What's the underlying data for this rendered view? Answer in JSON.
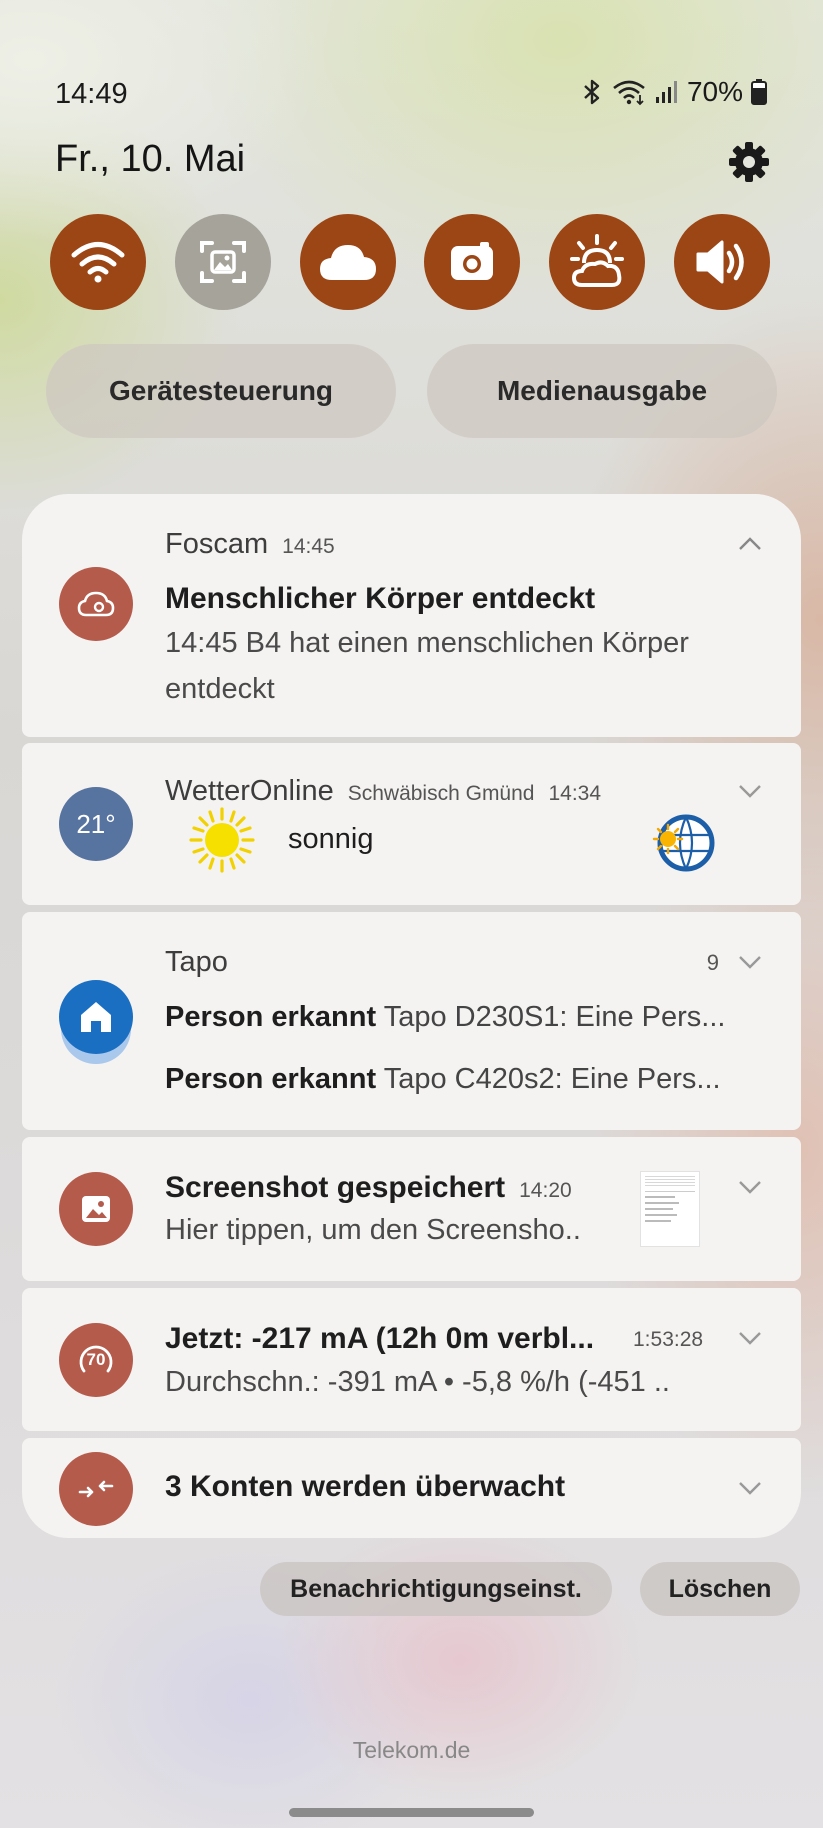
{
  "status": {
    "time": "14:49",
    "battery_pct": "70%",
    "icons": [
      "bluetooth-icon",
      "wifi-icon",
      "signal-icon",
      "battery-icon"
    ]
  },
  "header": {
    "date": "Fr., 10. Mai",
    "settings_icon": "gear-icon"
  },
  "quick_settings": [
    {
      "name": "wifi",
      "icon": "wifi-icon",
      "active": true
    },
    {
      "name": "screenshot",
      "icon": "screen-capture-icon",
      "active": false
    },
    {
      "name": "cloud",
      "icon": "cloud-icon",
      "active": true
    },
    {
      "name": "camera",
      "icon": "camera-icon",
      "active": true
    },
    {
      "name": "weather",
      "icon": "sun-cloud-icon",
      "active": true
    },
    {
      "name": "sound",
      "icon": "speaker-icon",
      "active": true
    }
  ],
  "pills": {
    "device_control": "Gerätesteuerung",
    "media_output": "Medienausgabe"
  },
  "notifications": {
    "foscam": {
      "app": "Foscam",
      "time": "14:45",
      "title": "Menschlicher Körper entdeckt",
      "body": "14:45 B4 hat einen menschlichen Körper entdeckt"
    },
    "wetter": {
      "app": "WetterOnline",
      "location": "Schwäbisch Gmünd",
      "time": "14:34",
      "temp": "21°",
      "condition": "sonnig"
    },
    "tapo": {
      "app": "Tapo",
      "count": "9",
      "line1_bold": "Person erkannt",
      "line1_text": "Tapo D230S1: Eine Pers...",
      "line2_bold": "Person erkannt",
      "line2_text": "Tapo C420s2: Eine Pers..."
    },
    "screenshot": {
      "title": "Screenshot gespeichert",
      "time": "14:20",
      "body": "Hier tippen, um den Screensho.."
    },
    "battery": {
      "title": "Jetzt: -217 mA (12h 0m verbl...",
      "time": "1:53:28",
      "body": "Durchschn.: -391 mA • -5,8 %/h (-451 ..",
      "badge": "70"
    },
    "accounts": {
      "title": "3 Konten werden überwacht"
    }
  },
  "actions": {
    "settings": "Benachrichtigungseinst.",
    "clear": "Löschen"
  },
  "carrier": "Telekom.de",
  "colors": {
    "accent": "#9c4616",
    "inactive": "#a6a39b",
    "avatar": "#b35a4a",
    "weather_avatar": "#5773a0",
    "tapo_blue": "#1a6fc2"
  }
}
